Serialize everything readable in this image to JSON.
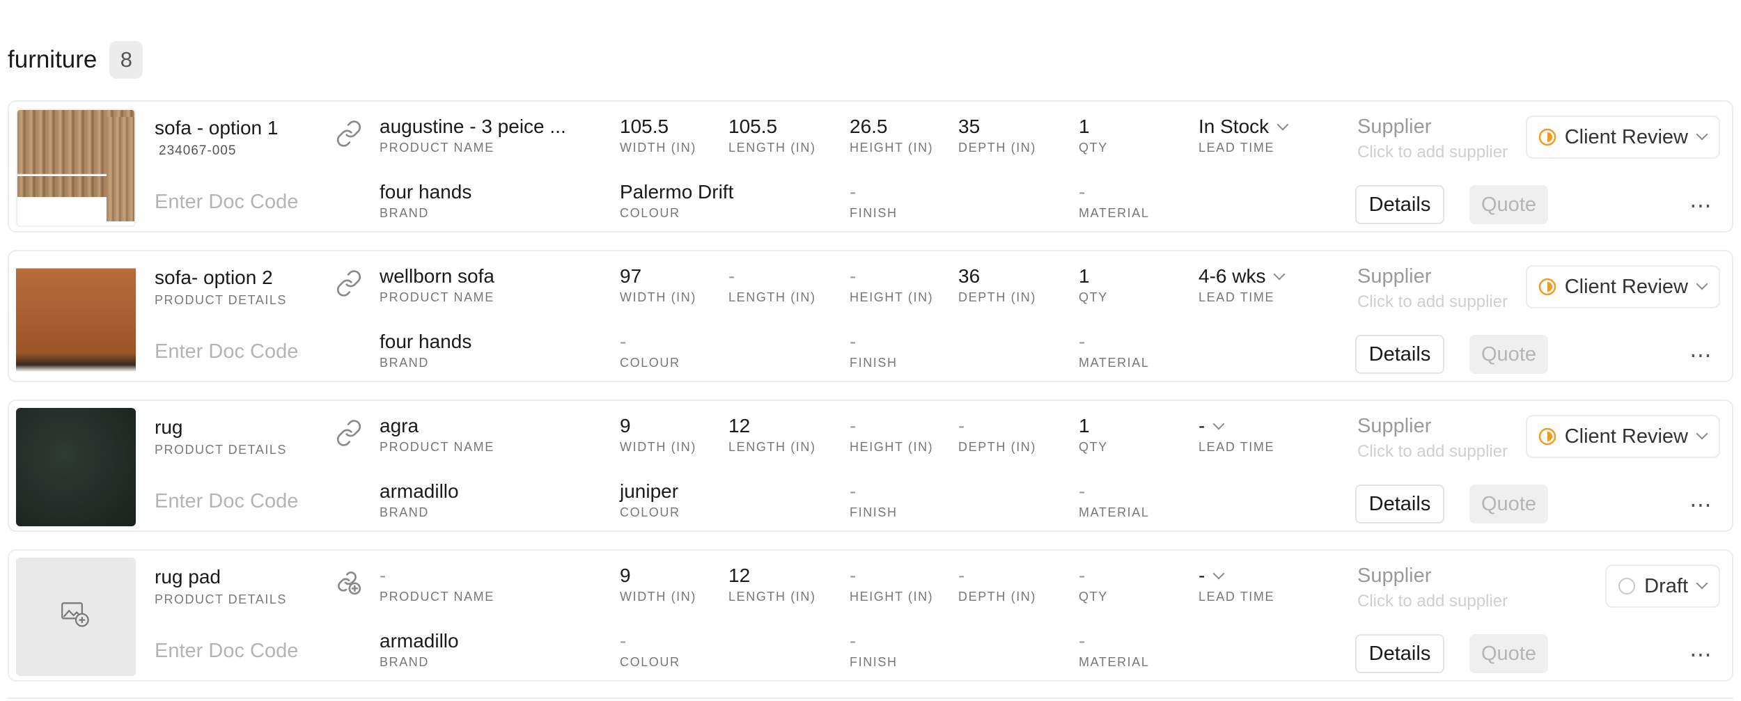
{
  "group": {
    "title": "furniture",
    "count": "8"
  },
  "colors": {
    "accent_status": "#f29a1f",
    "draft_circle": "#c8c8c8"
  },
  "placeholders": {
    "doc_code": "Enter Doc Code",
    "supplier_title": "Supplier",
    "supplier_hint": "Click to add supplier"
  },
  "labels": {
    "product_name": "PRODUCT NAME",
    "brand": "BRAND",
    "width": "WIDTH (IN)",
    "length": "LENGTH (IN)",
    "height": "HEIGHT (IN)",
    "depth": "DEPTH (IN)",
    "qty": "QTY",
    "lead_time": "LEAD TIME",
    "colour": "COLOUR",
    "finish": "FINISH",
    "material": "MATERIAL",
    "product_details": "PRODUCT DETAILS"
  },
  "buttons": {
    "details": "Details",
    "quote": "Quote",
    "more": "⋯"
  },
  "items": [
    {
      "name": "sofa - option 1",
      "sku": "234067-005",
      "product_name": "augustine - 3 peice ...",
      "width": "105.5",
      "length": "105.5",
      "height": "26.5",
      "depth": "35",
      "qty": "1",
      "lead_time": "In Stock",
      "brand": "four hands",
      "colour": "Palermo Drift",
      "finish": "-",
      "material": "-",
      "status": "Client Review",
      "thumb": "sofa-tan"
    },
    {
      "name": "sofa- option 2",
      "product_name": "wellborn sofa",
      "width": "97",
      "length": "-",
      "height": "-",
      "depth": "36",
      "qty": "1",
      "lead_time": "4-6 wks",
      "brand": "four hands",
      "colour": "-",
      "finish": "-",
      "material": "-",
      "status": "Client Review",
      "thumb": "sofa-cognac"
    },
    {
      "name": "rug",
      "product_name": "agra",
      "width": "9",
      "length": "12",
      "height": "-",
      "depth": "-",
      "qty": "1",
      "lead_time": "-",
      "brand": "armadillo",
      "colour": "juniper",
      "finish": "-",
      "material": "-",
      "status": "Client Review",
      "thumb": "rug-dark-green"
    },
    {
      "name": "rug pad",
      "product_name": "-",
      "width": "9",
      "length": "12",
      "height": "-",
      "depth": "-",
      "qty": "-",
      "lead_time": "-",
      "brand": "armadillo",
      "colour": "-",
      "finish": "-",
      "material": "-",
      "status": "Draft",
      "thumb": "add-image-icon"
    }
  ]
}
